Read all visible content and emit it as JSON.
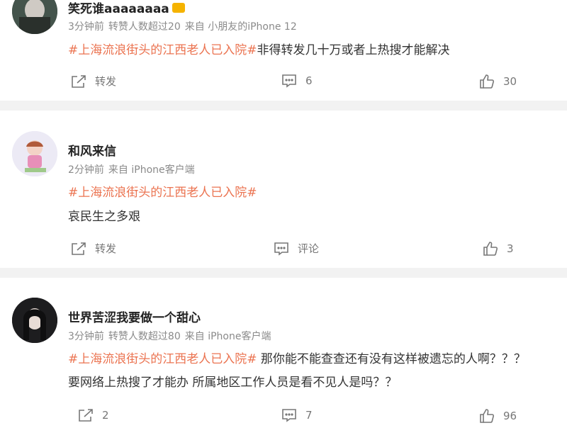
{
  "posts": [
    {
      "username": "笑死谁aaaaaaaa",
      "meta": [
        "3分钟前",
        "转赞人数超过20",
        "来自 小朋友的iPhone 12"
      ],
      "lines": [
        {
          "tag": "#上海流浪街头的江西老人已入院#",
          "text": "非得转发几十万或者上热搜才能解决"
        }
      ],
      "actions": {
        "repost": "转发",
        "comment": "6",
        "like": "30"
      }
    },
    {
      "username": "和风来信",
      "meta": [
        "2分钟前",
        "来自 iPhone客户端"
      ],
      "lines": [
        {
          "tag": "#上海流浪街头的江西老人已入院#",
          "text": ""
        },
        {
          "tag": "",
          "text": "哀民生之多艰"
        }
      ],
      "actions": {
        "repost": "转发",
        "comment": "评论",
        "like": "3"
      }
    },
    {
      "username": "世界苦涩我要做一个甜心",
      "meta": [
        "3分钟前",
        "转赞人数超过80",
        "来自 iPhone客户端"
      ],
      "lines": [
        {
          "tag": "#上海流浪街头的江西老人已入院#",
          "text": " 那你能不能查查还有没有这样被遗忘的人啊？？？"
        },
        {
          "tag": "",
          "text": "要网络上热搜了才能办 所属地区工作人员是看不见人是吗？？"
        }
      ],
      "actions": {
        "repost": "2",
        "comment": "7",
        "like": "96"
      }
    }
  ],
  "colors": {
    "topic": "#eb7350",
    "meta": "#8a8a8a",
    "divider": "#f2f2f2"
  },
  "icons": {
    "repost": "share-icon",
    "comment": "comment-icon",
    "like": "thumbs-up-icon"
  }
}
